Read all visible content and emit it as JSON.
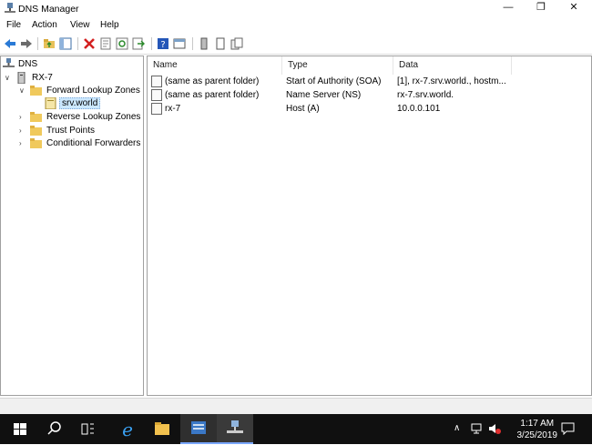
{
  "window": {
    "title": "DNS Manager"
  },
  "menu": [
    "File",
    "Action",
    "View",
    "Help"
  ],
  "tree": {
    "root": "DNS",
    "server": "RX-7",
    "forward": "Forward Lookup Zones",
    "zone": "srv.world",
    "reverse": "Reverse Lookup Zones",
    "trust": "Trust Points",
    "conditional": "Conditional Forwarders"
  },
  "list": {
    "columns": [
      "Name",
      "Type",
      "Data"
    ],
    "rows": [
      {
        "name": "(same as parent folder)",
        "type": "Start of Authority (SOA)",
        "data": "[1], rx-7.srv.world., hostm..."
      },
      {
        "name": "(same as parent folder)",
        "type": "Name Server (NS)",
        "data": "rx-7.srv.world."
      },
      {
        "name": "rx-7",
        "type": "Host (A)",
        "data": "10.0.0.101"
      }
    ]
  },
  "taskbar": {
    "time": "1:17 AM",
    "date": "3/25/2019"
  },
  "colors": {
    "selection": "#cce8ff",
    "taskbar": "#101010",
    "accent": "#2b6cb0"
  }
}
